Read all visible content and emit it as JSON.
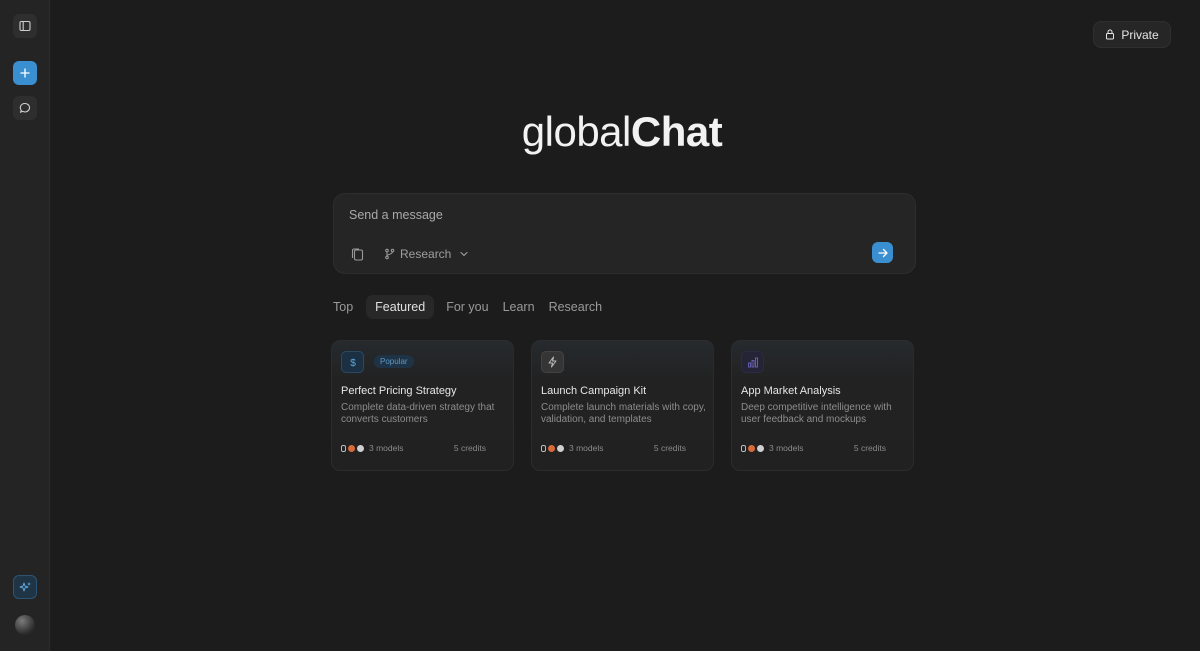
{
  "sidebar": {
    "icons": [
      "panel-toggle-icon",
      "plus-icon",
      "chat-bubble-icon",
      "sparkle-icon"
    ]
  },
  "header": {
    "private_label": "Private"
  },
  "logo": {
    "light": "global",
    "bold": "Chat"
  },
  "composer": {
    "placeholder": "Send a message",
    "mode_label": "Research"
  },
  "tabs": [
    {
      "label": "Top",
      "active": false
    },
    {
      "label": "Featured",
      "active": true
    },
    {
      "label": "For you",
      "active": false
    },
    {
      "label": "Learn",
      "active": false
    },
    {
      "label": "Research",
      "active": false
    }
  ],
  "cards": [
    {
      "icon": "dollar-icon",
      "badge": "Popular",
      "title": "Perfect Pricing Strategy",
      "desc": "Complete data-driven strategy that converts customers",
      "models": "3 models",
      "credits": "5 credits"
    },
    {
      "icon": "lightning-icon",
      "badge": "",
      "title": "Launch Campaign Kit",
      "desc": "Complete launch materials with copy, validation, and templates",
      "models": "3 models",
      "credits": "5 credits"
    },
    {
      "icon": "bar-chart-icon",
      "badge": "",
      "title": "App Market Analysis",
      "desc": "Deep competitive intelligence with user feedback and mockups",
      "models": "3 models",
      "credits": "5 credits"
    }
  ],
  "colors": {
    "accent": "#3a8fd0",
    "background": "#1c1c1c",
    "sidebar": "#242424"
  }
}
